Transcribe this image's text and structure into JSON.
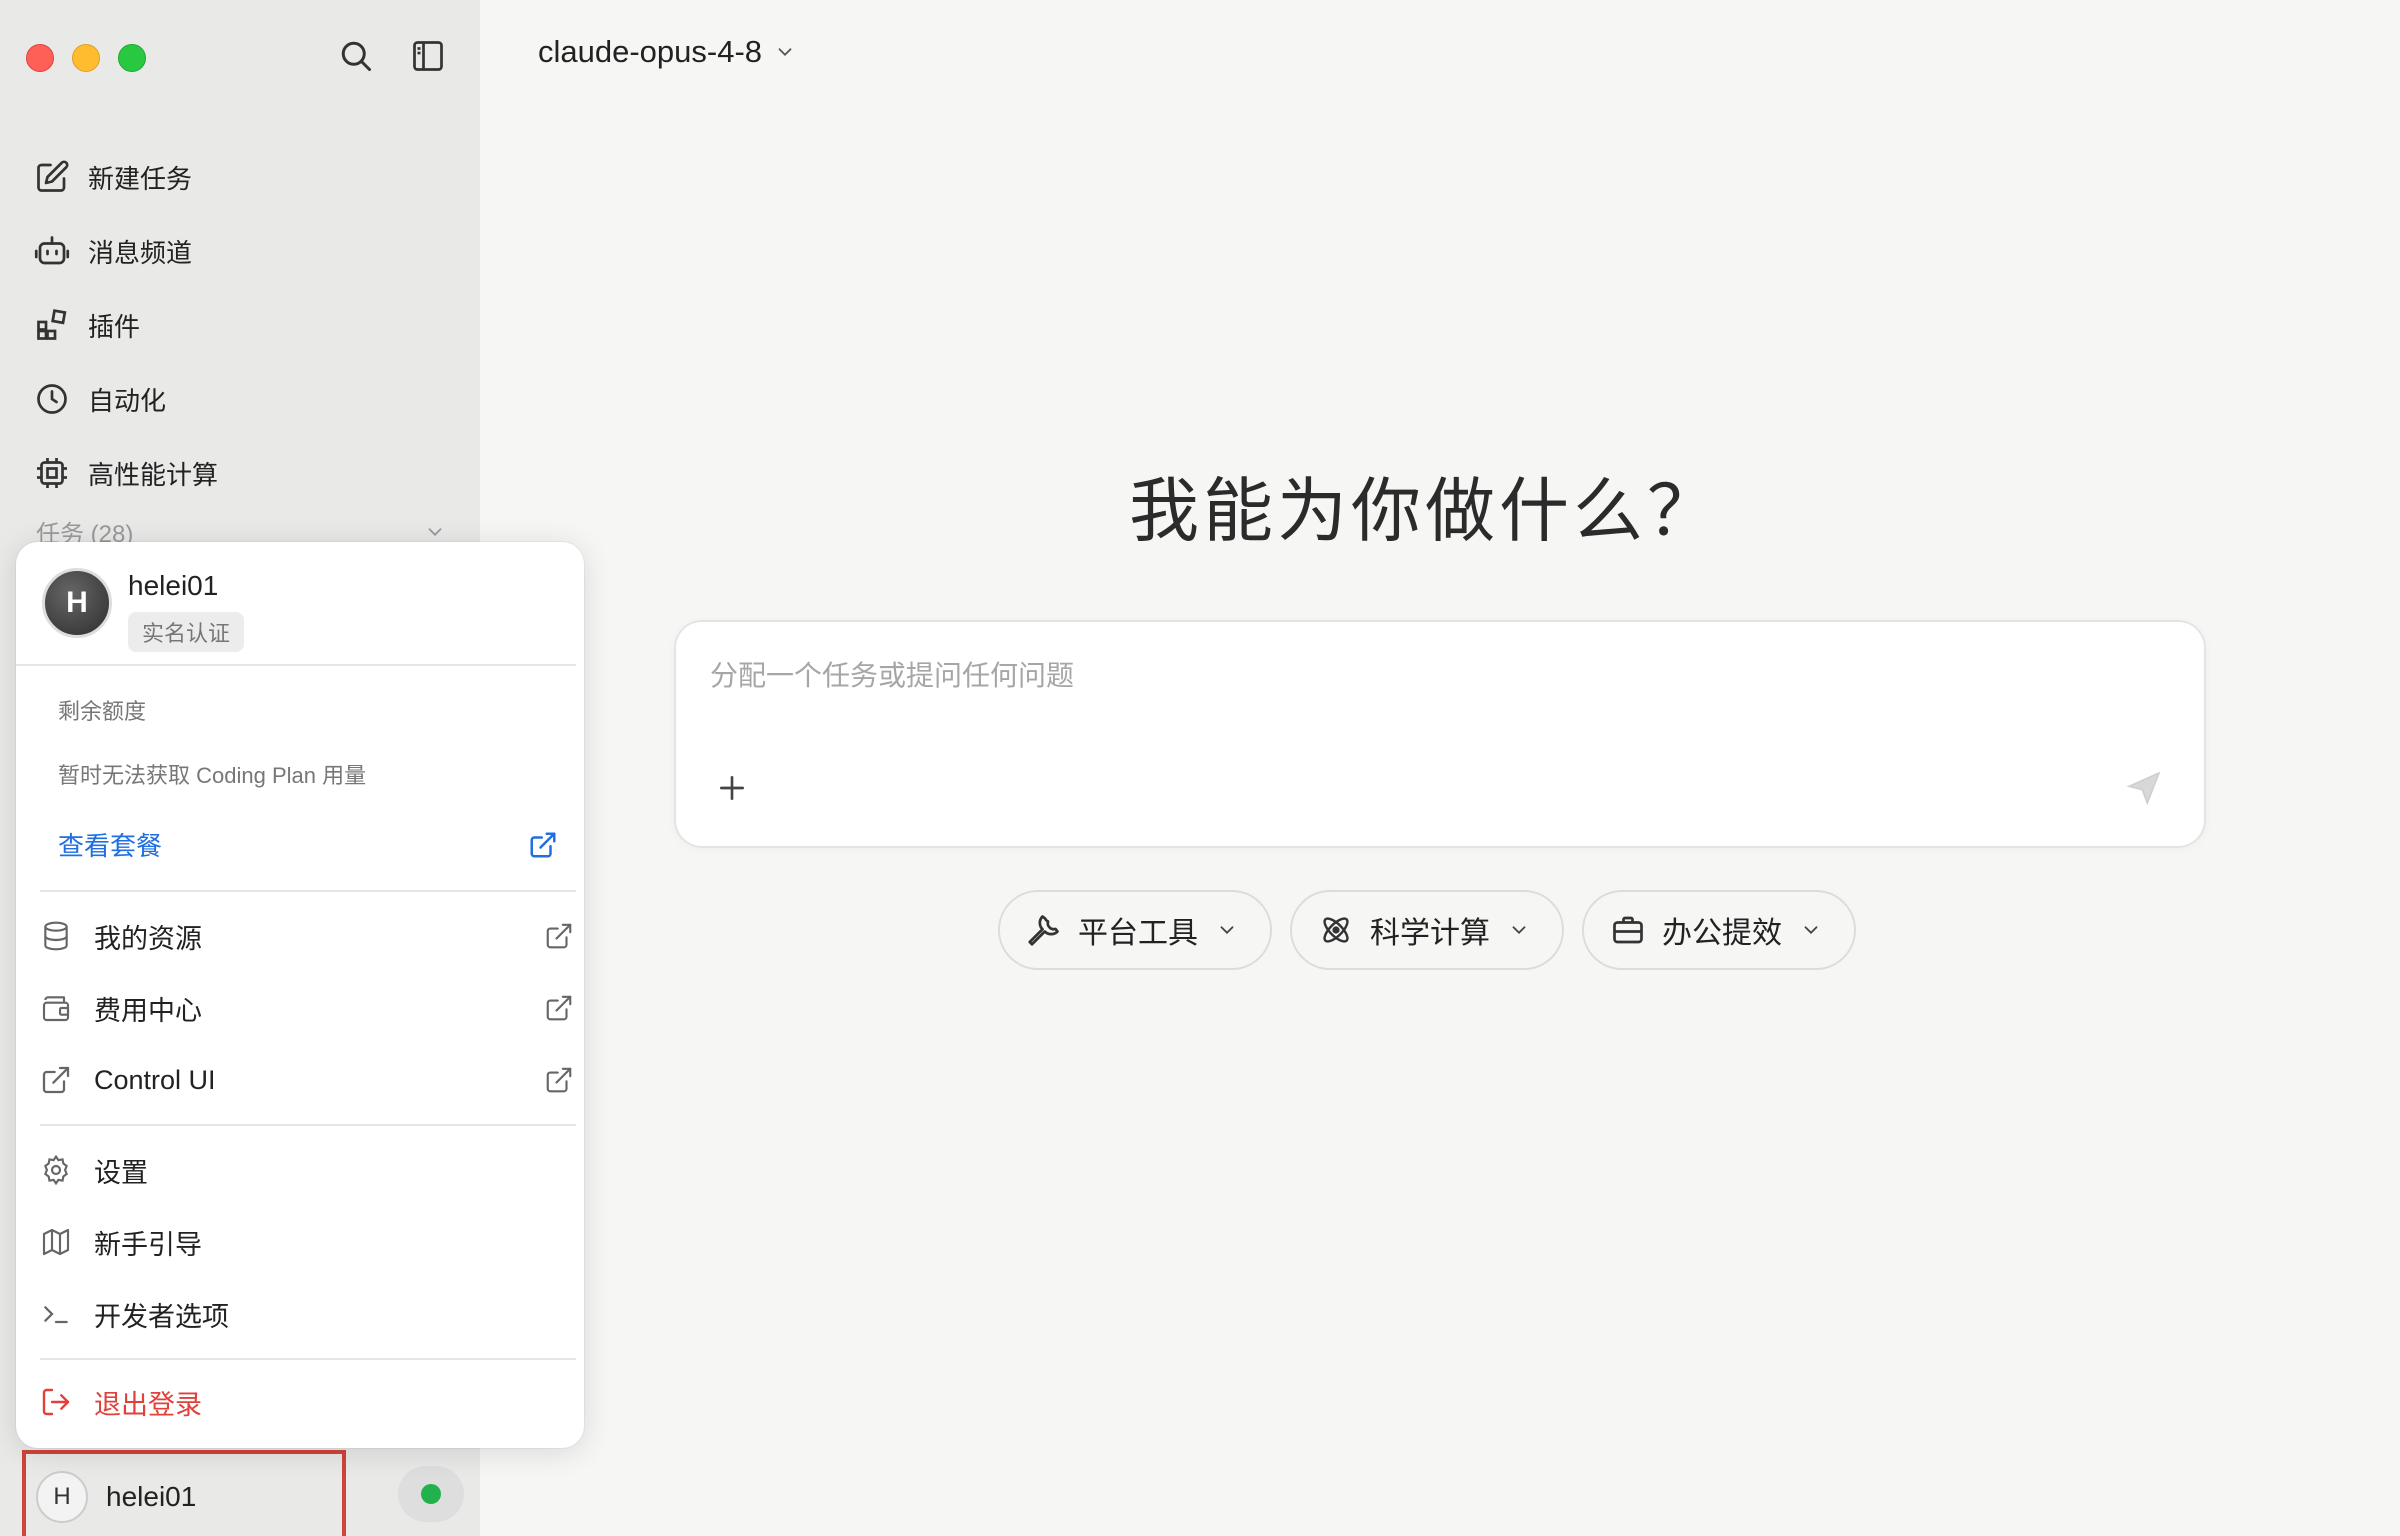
{
  "model": {
    "name": "claude-opus-4-8"
  },
  "sidebar": {
    "items": [
      {
        "label": "新建任务",
        "icon": "edit-icon"
      },
      {
        "label": "消息频道",
        "icon": "bot-icon"
      },
      {
        "label": "插件",
        "icon": "plugin-grid-icon"
      },
      {
        "label": "自动化",
        "icon": "clock-icon"
      },
      {
        "label": "高性能计算",
        "icon": "cpu-chip-icon"
      }
    ],
    "tasks_header": "任务 (28)"
  },
  "user": {
    "avatar_initial": "H",
    "name": "helei01",
    "verify_badge": "实名认证",
    "status_color": "#22b14c"
  },
  "popup": {
    "quota_label": "剩余额度",
    "quota_message": "暂时无法获取 Coding Plan 用量",
    "plan_link": "查看套餐",
    "menu": {
      "resources": "我的资源",
      "billing": "费用中心",
      "control_ui": "Control UI",
      "settings": "设置",
      "guide": "新手引导",
      "developer": "开发者选项",
      "logout": "退出登录"
    }
  },
  "main": {
    "title": "我能为你做什么？",
    "composer_placeholder": "分配一个任务或提问任何问题",
    "chips": [
      "平台工具",
      "科学计算",
      "办公提效"
    ]
  },
  "colors": {
    "accent_link": "#1f6fe0",
    "danger": "#e0413a",
    "highlight_border": "#d0433a"
  }
}
